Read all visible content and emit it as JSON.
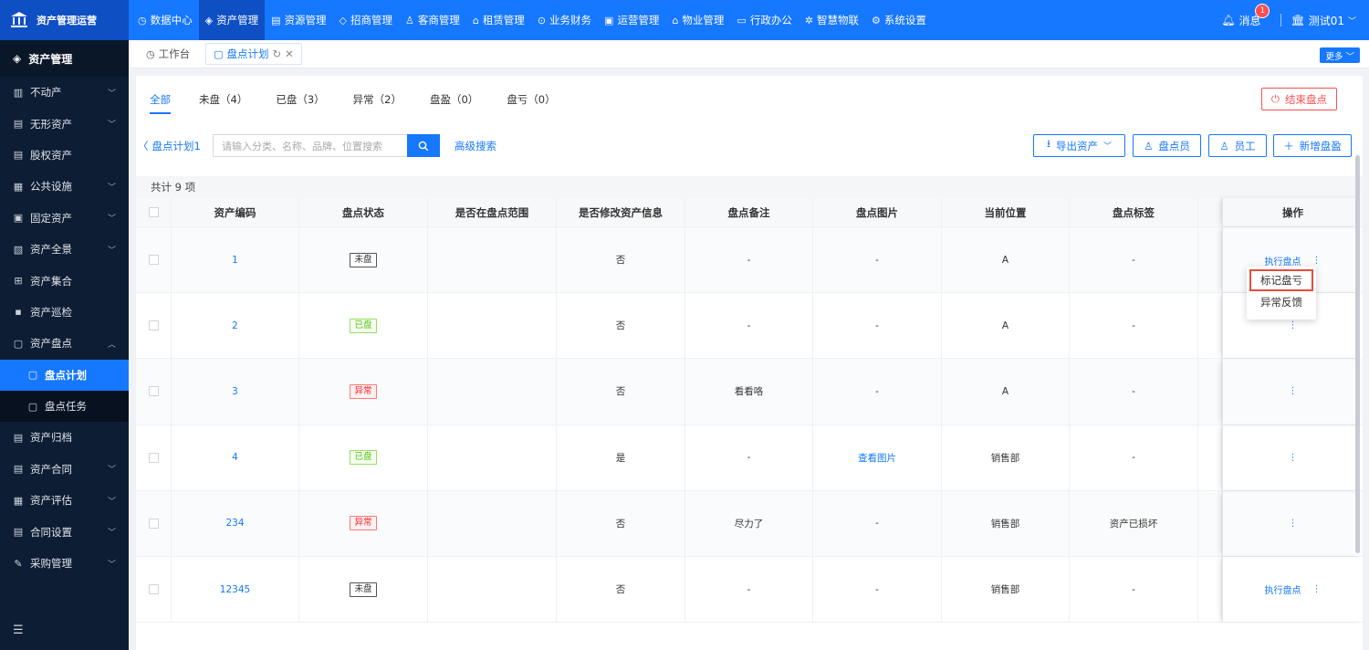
{
  "app": {
    "title": "资产管理运营"
  },
  "topnav": {
    "items": [
      {
        "label": "数据中心",
        "icon": "dashboard-icon"
      },
      {
        "label": "资产管理",
        "icon": "cube-icon",
        "active": true
      },
      {
        "label": "资源管理",
        "icon": "building-icon"
      },
      {
        "label": "招商管理",
        "icon": "tag-icon"
      },
      {
        "label": "客商管理",
        "icon": "users-icon"
      },
      {
        "label": "租赁管理",
        "icon": "house-icon"
      },
      {
        "label": "业务财务",
        "icon": "money-icon"
      },
      {
        "label": "运营管理",
        "icon": "chart-icon"
      },
      {
        "label": "物业管理",
        "icon": "home-icon"
      },
      {
        "label": "行政办公",
        "icon": "monitor-icon"
      },
      {
        "label": "智慧物联",
        "icon": "iot-icon"
      },
      {
        "label": "系统设置",
        "icon": "gear-icon"
      }
    ],
    "messages_label": "消息",
    "messages_badge": "1",
    "user_label": "测试01"
  },
  "sidebar": {
    "header": "资产管理",
    "items": [
      {
        "label": "不动产",
        "expandable": true
      },
      {
        "label": "无形资产",
        "expandable": true
      },
      {
        "label": "股权资产",
        "expandable": false
      },
      {
        "label": "公共设施",
        "expandable": true
      },
      {
        "label": "固定资产",
        "expandable": true
      },
      {
        "label": "资产全景",
        "expandable": true
      },
      {
        "label": "资产集合",
        "expandable": false
      },
      {
        "label": "资产巡检",
        "expandable": false
      },
      {
        "label": "资产盘点",
        "expandable": true,
        "open": true
      },
      {
        "label": "盘点计划",
        "sub": true,
        "active": true
      },
      {
        "label": "盘点任务",
        "sub": true
      },
      {
        "label": "资产归档",
        "expandable": false
      },
      {
        "label": "资产合同",
        "expandable": true
      },
      {
        "label": "资产评估",
        "expandable": true
      },
      {
        "label": "合同设置",
        "expandable": true
      },
      {
        "label": "采购管理",
        "expandable": true
      }
    ]
  },
  "tabs": {
    "items": [
      {
        "label": "工作台"
      },
      {
        "label": "盘点计划",
        "active": true
      }
    ],
    "more_label": "更多"
  },
  "filters": {
    "tabs": [
      "全部",
      "未盘（4）",
      "已盘（3）",
      "异常（2）",
      "盘盈（0）",
      "盘亏（0）"
    ],
    "end_button": "结束盘点"
  },
  "toolbar": {
    "back_label": "盘点计划1",
    "search_placeholder": "请输入分类、名称、品牌、位置搜索",
    "advanced_search": "高级搜索",
    "export_label": "导出资产",
    "inspector_label": "盘点员",
    "employee_label": "员工",
    "add_label": "新增盘盈"
  },
  "table": {
    "total_label": "共计 9 项",
    "headers": [
      "资产编码",
      "盘点状态",
      "是否在盘点范围",
      "是否修改资产信息",
      "盘点备注",
      "盘点图片",
      "当前位置",
      "盘点标签",
      "操作"
    ],
    "rows": [
      {
        "code": "1",
        "status": "未盘",
        "status_type": "unchecked",
        "in_scope": "",
        "modified": "否",
        "remark": "-",
        "image": "-",
        "location": "A",
        "label": "-",
        "op": "执行盘点"
      },
      {
        "code": "2",
        "status": "已盘",
        "status_type": "checked",
        "in_scope": "",
        "modified": "否",
        "remark": "-",
        "image": "-",
        "location": "A",
        "label": "-",
        "op": ""
      },
      {
        "code": "3",
        "status": "异常",
        "status_type": "abnormal",
        "in_scope": "",
        "modified": "否",
        "remark": "看看咯",
        "image": "-",
        "location": "A",
        "label": "-",
        "op": ""
      },
      {
        "code": "4",
        "status": "已盘",
        "status_type": "checked",
        "in_scope": "",
        "modified": "是",
        "remark": "-",
        "image": "查看图片",
        "location": "销售部",
        "label": "-",
        "op": ""
      },
      {
        "code": "234",
        "status": "异常",
        "status_type": "abnormal",
        "in_scope": "",
        "modified": "否",
        "remark": "尽力了",
        "image": "-",
        "location": "销售部",
        "label": "资产已损坏",
        "op": ""
      },
      {
        "code": "12345",
        "status": "未盘",
        "status_type": "unchecked",
        "in_scope": "",
        "modified": "否",
        "remark": "-",
        "image": "-",
        "location": "销售部",
        "label": "-",
        "op": "执行盘点"
      }
    ]
  },
  "dropdown": {
    "items": [
      "标记盘亏",
      "异常反馈"
    ]
  },
  "colors": {
    "primary": "#1677ff",
    "sidebar_bg": "#0d1d33",
    "danger": "#ff4d4f",
    "success": "#52c41a"
  }
}
